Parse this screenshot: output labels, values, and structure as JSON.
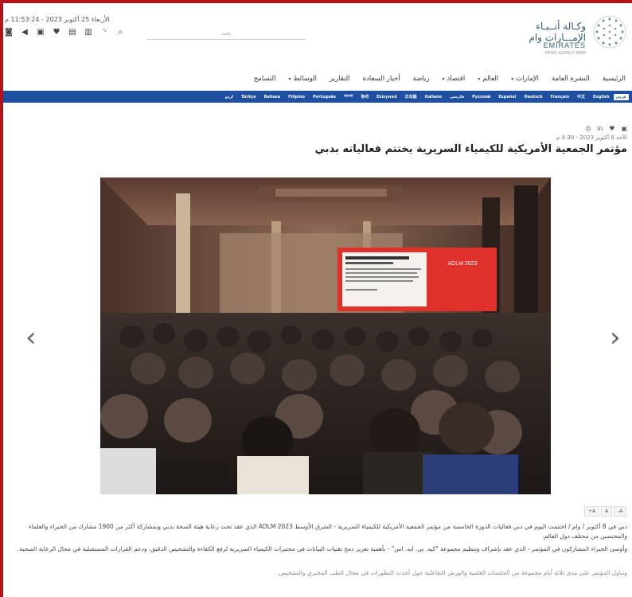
{
  "header": {
    "date_line": "الأربعاء 25 أكتوبر 2023 - 11:53:24 م",
    "search_placeholder": "بحث",
    "social_icons": [
      "instagram-icon",
      "telegram-icon",
      "facebook-icon",
      "twitter-icon",
      "flickr-icon",
      "youtube-icon",
      "rss-icon",
      "search-icon"
    ],
    "logo_ar": "وكـالة أنــبـاء الإمـــارات وام",
    "logo_en": "EMIRATES",
    "logo_sub": "NEWS AGENCY WAM"
  },
  "nav": {
    "items": [
      {
        "label": "الرئيسية",
        "dropdown": false
      },
      {
        "label": "النشرة العامة",
        "dropdown": false
      },
      {
        "label": "الإمارات",
        "dropdown": true
      },
      {
        "label": "العالم",
        "dropdown": true
      },
      {
        "label": "اقتصاد",
        "dropdown": true
      },
      {
        "label": "رياضة",
        "dropdown": false
      },
      {
        "label": "أخبار السعادة",
        "dropdown": false
      },
      {
        "label": "التقارير",
        "dropdown": false
      },
      {
        "label": "الوسائط",
        "dropdown": true
      },
      {
        "label": "التسامح",
        "dropdown": false
      }
    ]
  },
  "langbar": {
    "items": [
      "عربي",
      "English",
      "中文",
      "Français",
      "Deutsch",
      "Español",
      "Русский",
      "فارسی",
      "Italiano",
      "日本語",
      "Ελληνικά",
      "हिन्दी",
      "বাংলা",
      "Português",
      "Filipino",
      "Bahasa",
      "Türkçe",
      "اردو"
    ],
    "active": "عربي"
  },
  "article": {
    "share_icons": [
      "print-icon",
      "linkedin-icon",
      "twitter-icon",
      "facebook-icon"
    ],
    "date": "الأحد 8 أكتوبر 2023 - 4:39 م",
    "title": "مؤتمر الجمعية الأمريكية للكيمياء السريرية يختتم فعالياته بدبي",
    "font_controls": [
      "+A",
      "A",
      "-A"
    ],
    "paragraphs": [
      "دبي في 8 أكتوبر / وام / اختتمت اليوم في دبي فعاليات الدورة الخامسة من مؤتمر الجمعية الأمريكية للكيمياء السريرية - الشرق الأوسط ADLM 2023 الذي عقد تحت رعاية هيئة الصحة بدبي وبمشاركة أكثر من 1900 مشارك من الخبراء والعلماء والمختصين من مختلف دول العالم.",
      "وأوصى الخبراء المشاركون في المؤتمر - الذي عقد بإشراف وتنظيم مجموعة \"كيه. بي. ايه. اس\" - بأهمية تعزيز دمج تقنيات البيانات في مختبرات الكيمياء السريرية لرفع الكفاءة والتشخيص الدقيق، ودعم القرارات المستقبلية في مجال الرعاية الصحية.",
      "وتناول المؤتمر على مدى ثلاثة أيام مجموعة من الجلسات العلمية والورش التفاعلية حول أحدث التطورات في مجال الطب المخبري والتشخيص."
    ]
  },
  "photo": {
    "screen_title": "ADLM 2023",
    "slide_heading": "Biomarkers for Chronic Disease Management"
  }
}
